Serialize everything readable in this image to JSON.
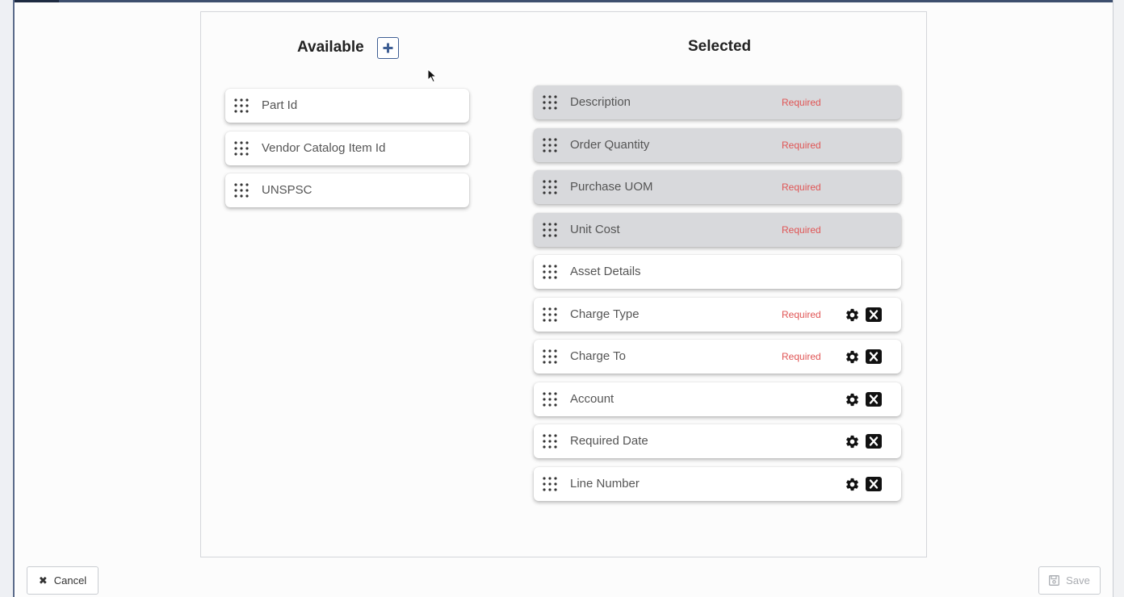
{
  "available": {
    "title": "Available",
    "items": [
      "Part Id",
      "Vendor Catalog Item Id",
      "UNSPSC"
    ]
  },
  "selected": {
    "title": "Selected",
    "items": [
      {
        "label": "Description",
        "required_text": "Required",
        "locked": true,
        "actions": false
      },
      {
        "label": "Order Quantity",
        "required_text": "Required",
        "locked": true,
        "actions": false
      },
      {
        "label": "Purchase UOM",
        "required_text": "Required",
        "locked": true,
        "actions": false
      },
      {
        "label": "Unit Cost",
        "required_text": "Required",
        "locked": true,
        "actions": false
      },
      {
        "label": "Asset Details",
        "required_text": "",
        "locked": false,
        "actions": false
      },
      {
        "label": "Charge Type",
        "required_text": "Required",
        "locked": false,
        "actions": true
      },
      {
        "label": "Charge To",
        "required_text": "Required",
        "locked": false,
        "actions": true
      },
      {
        "label": "Account",
        "required_text": "",
        "locked": false,
        "actions": true
      },
      {
        "label": "Required Date",
        "required_text": "",
        "locked": false,
        "actions": true
      },
      {
        "label": "Line Number",
        "required_text": "",
        "locked": false,
        "actions": true
      }
    ]
  },
  "footer": {
    "cancel_label": "Cancel",
    "save_label": "Save"
  },
  "icons": {
    "add": "plus-icon",
    "drag": "drag-handle-icon",
    "settings": "gear-icon",
    "remove": "close-box-icon",
    "cancel": "x-icon",
    "save": "floppy-disk-icon"
  },
  "colors": {
    "required": "#e05555",
    "accent": "#3f5f94",
    "locked_card": "#d8d9dc"
  }
}
